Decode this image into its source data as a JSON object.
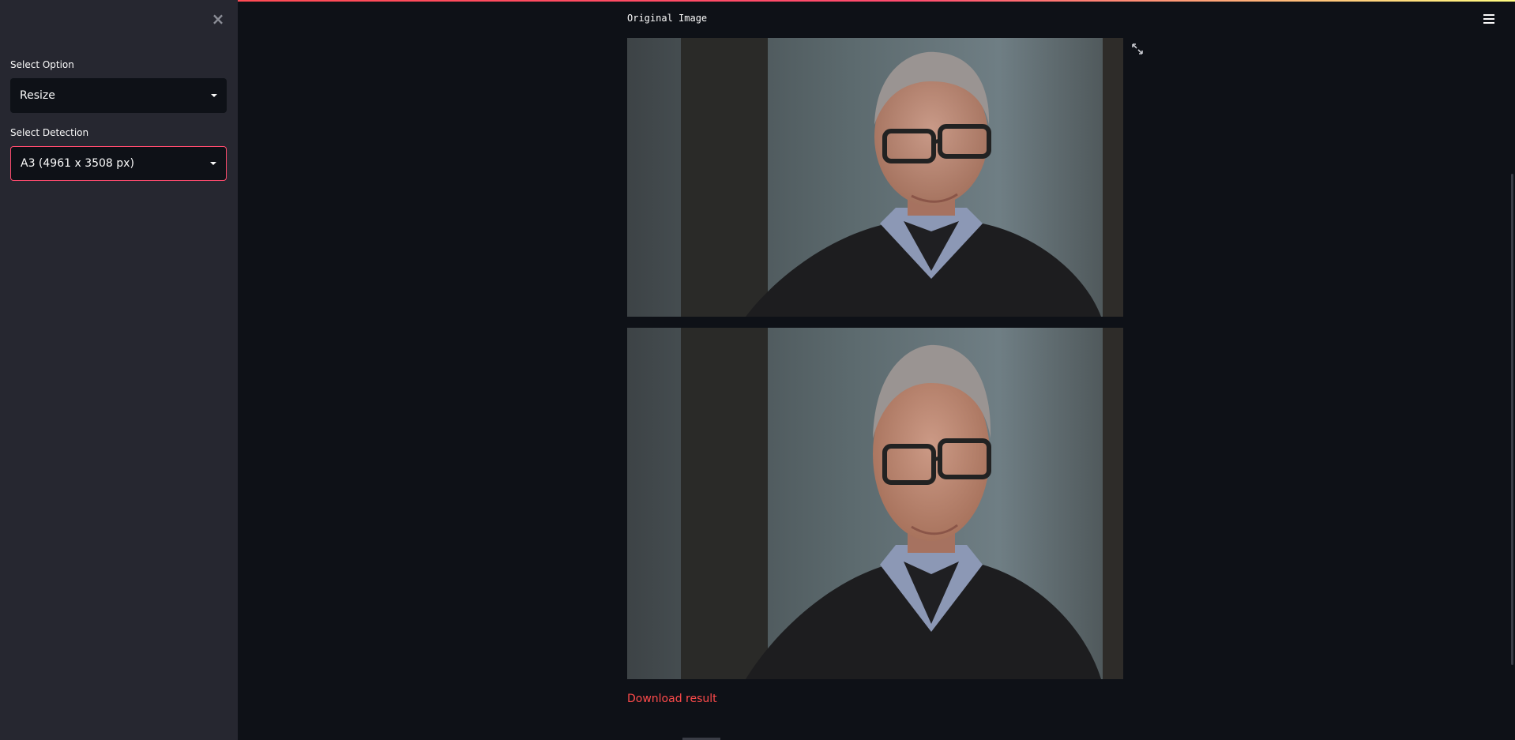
{
  "sidebar": {
    "close_icon": "close-icon",
    "option_label": "Select Option",
    "option_value": "Resize",
    "detection_label": "Select Detection",
    "detection_value": "A3 (4961 x 3508 px)"
  },
  "main": {
    "title": "Original Image",
    "download_label": "Download result",
    "expand_icon": "expand-icon",
    "menu_icon": "hamburger-menu-icon"
  },
  "colors": {
    "background": "#0e1117",
    "sidebar": "#262730",
    "accent": "#ff4b4b",
    "focus_border": "#ff4b6e"
  }
}
